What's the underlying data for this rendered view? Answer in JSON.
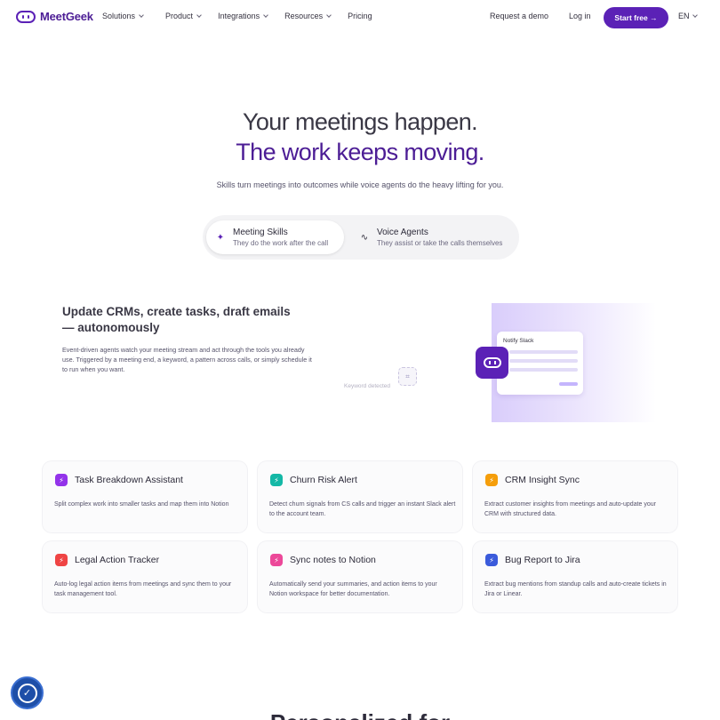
{
  "nav": {
    "logo": "MeetGeek",
    "links": [
      "Solutions",
      "Product",
      "Integrations",
      "Resources",
      "Pricing"
    ],
    "request_demo": "Request a demo",
    "login": "Log in",
    "start_free": "Start free →",
    "lang": "EN"
  },
  "hero": {
    "line1": "Your meetings happen.",
    "line2": "The work keeps moving.",
    "subtitle": "Skills turn meetings into outcomes while voice agents do the heavy lifting for you."
  },
  "tabs": [
    {
      "title": "Meeting Skills",
      "subtitle": "They do the work after the call",
      "active": true
    },
    {
      "title": "Voice Agents",
      "subtitle": "They assist or take the calls themselves",
      "active": false
    }
  ],
  "feature": {
    "title": "Update CRMs, create tasks, draft emails — autonomously",
    "description": "Event-driven agents watch your meeting stream and act through the tools you already use. Triggered by a meeting end, a keyword, a pattern across calls, or simply schedule it to run when you want.",
    "visual": {
      "keyword_label": "Keyword detected",
      "notify_title": "Notify Slack"
    }
  },
  "cards": [
    {
      "title": "Task Breakdown Assistant",
      "description": "Split complex work into smaller tasks and map them into Notion",
      "color": "#9333ea"
    },
    {
      "title": "Churn Risk Alert",
      "description": "Detect churn signals from CS calls and trigger an instant Slack alert to the account team.",
      "color": "#14b8a6"
    },
    {
      "title": "CRM Insight Sync",
      "description": "Extract customer insights from meetings and auto-update your CRM with structured data.",
      "color": "#f59e0b"
    },
    {
      "title": "Legal Action Tracker",
      "description": "Auto-log legal action items from meetings and sync them to your task management tool.",
      "color": "#ef4444"
    },
    {
      "title": "Sync notes to Notion",
      "description": "Automatically send your summaries, and action items to your Notion workspace for better documentation.",
      "color": "#ec4899"
    },
    {
      "title": "Bug Report to Jira",
      "description": "Extract bug mentions from standup calls and auto-create tickets in Jira or Linear.",
      "color": "#3b5bdb"
    }
  ],
  "bottom_heading": "Personalized for"
}
